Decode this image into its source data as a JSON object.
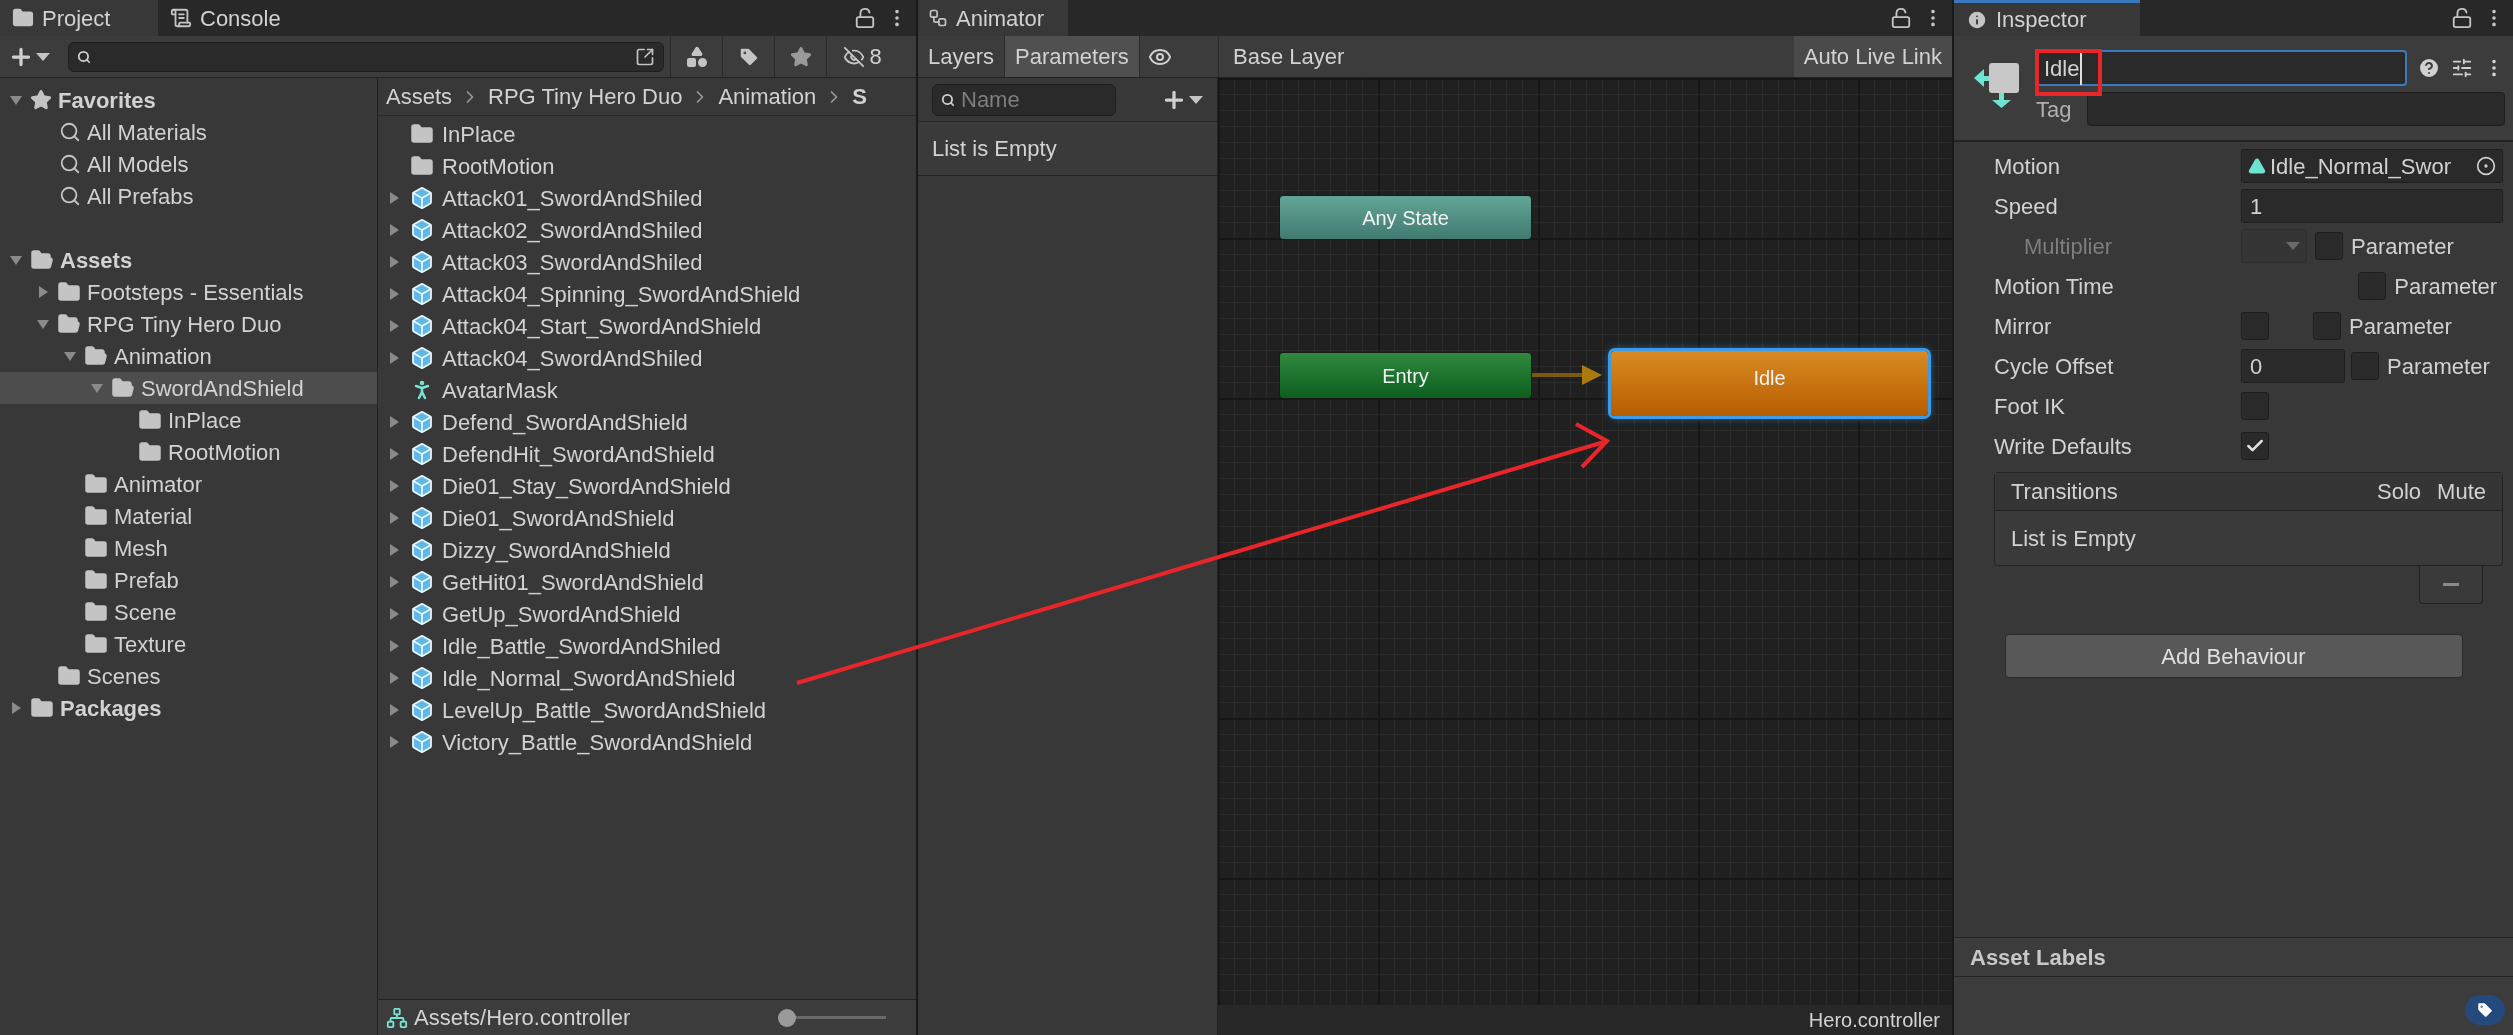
{
  "project": {
    "tabs": [
      {
        "label": "Project",
        "kind": "project",
        "selected": true
      },
      {
        "label": "Console",
        "kind": "console",
        "selected": false
      }
    ],
    "hidden_count": "8",
    "favorites": {
      "label": "Favorites",
      "expanded": true,
      "items": [
        "All Materials",
        "All Models",
        "All Prefabs"
      ]
    },
    "tree": [
      {
        "label": "Assets",
        "expanded": true,
        "selected": false,
        "children": [
          {
            "label": "Footsteps - Essentials",
            "expanded": false,
            "selected": false
          },
          {
            "label": "RPG Tiny Hero Duo",
            "expanded": true,
            "selected": false,
            "children": [
              {
                "label": "Animation",
                "expanded": true,
                "selected": false,
                "children": [
                  {
                    "label": "SwordAndShield",
                    "expanded": true,
                    "selected": true,
                    "children": [
                      {
                        "label": "InPlace",
                        "selected": false
                      },
                      {
                        "label": "RootMotion",
                        "selected": false
                      }
                    ]
                  }
                ]
              },
              {
                "label": "Animator",
                "selected": false
              },
              {
                "label": "Material",
                "selected": false
              },
              {
                "label": "Mesh",
                "selected": false
              },
              {
                "label": "Prefab",
                "selected": false
              },
              {
                "label": "Scene",
                "selected": false
              },
              {
                "label": "Texture",
                "selected": false
              }
            ]
          },
          {
            "label": "Scenes",
            "selected": false
          }
        ]
      },
      {
        "label": "Packages",
        "expanded": false,
        "selected": false
      }
    ],
    "breadcrumb": [
      "Assets",
      "RPG Tiny Hero Duo",
      "Animation",
      "S"
    ],
    "files": [
      {
        "name": "InPlace",
        "kind": "folder"
      },
      {
        "name": "RootMotion",
        "kind": "folder"
      },
      {
        "name": "Attack01_SwordAndShiled",
        "kind": "model"
      },
      {
        "name": "Attack02_SwordAndShiled",
        "kind": "model"
      },
      {
        "name": "Attack03_SwordAndShiled",
        "kind": "model"
      },
      {
        "name": "Attack04_Spinning_SwordAndShield",
        "kind": "model"
      },
      {
        "name": "Attack04_Start_SwordAndShield",
        "kind": "model"
      },
      {
        "name": "Attack04_SwordAndShiled",
        "kind": "model"
      },
      {
        "name": "AvatarMask",
        "kind": "mask"
      },
      {
        "name": "Defend_SwordAndShield",
        "kind": "model"
      },
      {
        "name": "DefendHit_SwordAndShield",
        "kind": "model"
      },
      {
        "name": "Die01_Stay_SwordAndShield",
        "kind": "model"
      },
      {
        "name": "Die01_SwordAndShield",
        "kind": "model"
      },
      {
        "name": "Dizzy_SwordAndShield",
        "kind": "model"
      },
      {
        "name": "GetHit01_SwordAndShield",
        "kind": "model"
      },
      {
        "name": "GetUp_SwordAndShield",
        "kind": "model"
      },
      {
        "name": "Idle_Battle_SwordAndShiled",
        "kind": "model"
      },
      {
        "name": "Idle_Normal_SwordAndShield",
        "kind": "model"
      },
      {
        "name": "LevelUp_Battle_SwordAndShield",
        "kind": "model"
      },
      {
        "name": "Victory_Battle_SwordAndShield",
        "kind": "model"
      }
    ],
    "status_path": "Assets/Hero.controller",
    "zoom": {
      "level": 0
    }
  },
  "animator": {
    "tab": "Animator",
    "subtabs": [
      {
        "label": "Layers",
        "selected": false
      },
      {
        "label": "Parameters",
        "selected": true
      }
    ],
    "layer": "Base Layer",
    "live_link": "Auto Live Link",
    "search": {
      "placeholder": "Name"
    },
    "empty": "List is Empty",
    "nodes": [
      {
        "label": "Any State",
        "kind": "any",
        "selected": false
      },
      {
        "label": "Entry",
        "kind": "entry",
        "selected": false
      },
      {
        "label": "Idle",
        "kind": "state",
        "selected": true
      }
    ],
    "status": "Hero.controller"
  },
  "inspector": {
    "tab": "Inspector",
    "name": "Idle",
    "tag_label": "Tag",
    "properties": [
      {
        "kind": "object",
        "label": "Motion",
        "value": "Idle_Normal_Swor"
      },
      {
        "kind": "number",
        "label": "Speed",
        "value": "1"
      },
      {
        "kind": "param_dropdown",
        "label": "Multiplier",
        "disabled": true,
        "param_checked": false,
        "param_label": "Parameter"
      },
      {
        "kind": "param_only",
        "label": "Motion Time",
        "param_checked": false,
        "param_label": "Parameter"
      },
      {
        "kind": "toggle_param",
        "label": "Mirror",
        "checked": false,
        "param_checked": false,
        "param_label": "Parameter"
      },
      {
        "kind": "number_param",
        "label": "Cycle Offset",
        "value": "0",
        "param_checked": false,
        "param_label": "Parameter"
      },
      {
        "kind": "toggle",
        "label": "Foot IK",
        "checked": false
      },
      {
        "kind": "toggle",
        "label": "Write Defaults",
        "checked": true
      }
    ],
    "transitions": {
      "title": "Transitions",
      "columns": [
        "Solo",
        "Mute"
      ],
      "empty": "List is Empty"
    },
    "add_button": "Add Behaviour",
    "labels_title": "Asset Labels"
  }
}
